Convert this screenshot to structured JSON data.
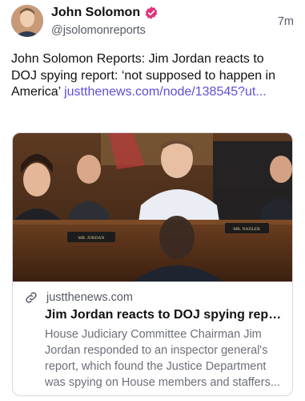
{
  "post": {
    "author_name": "John Solomon",
    "handle": "@jsolomonreports",
    "time": "7m",
    "text": "John Solomon Reports: Jim Jordan reacts to DOJ spying report: ‘not supposed to happen in America’ ",
    "link_text": "justthenews.com/node/138545?ut..."
  },
  "card": {
    "domain": "justthenews.com",
    "title": "Jim Jordan reacts to DOJ spying repo...",
    "description": "House Judiciary Committee Chairman Jim Jordan responded to an inspector general's report, which found the Justice Department was spying on House members and staffers...",
    "image_placard_left": "MR. JORDAN",
    "image_placard_right": "MR. NADLER"
  },
  "icons": {
    "verified": "verified-badge-icon",
    "link": "link-icon"
  },
  "colors": {
    "link": "#5b50d6",
    "verified": "#e0317a",
    "muted": "#555a63"
  }
}
